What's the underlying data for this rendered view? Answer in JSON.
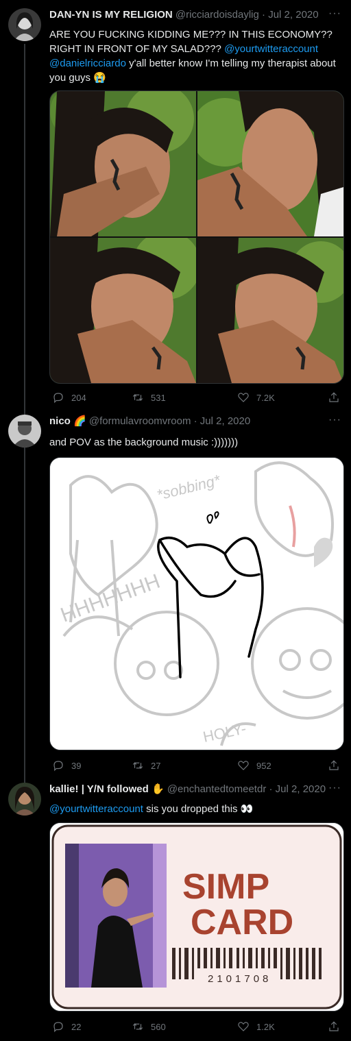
{
  "tweets": [
    {
      "name": "DAN-YN IS MY RELIGION",
      "handle": "@ricciardoisdaylig",
      "date": "Jul 2, 2020",
      "text_line1": "ARE YOU FUCKING KIDDING ME??? IN THIS ECONOMY??",
      "text_line2_a": "RIGHT IN FRONT OF MY SALAD??? ",
      "mention1": "@yourtwitteraccount",
      "mention2": "@danielricciardo",
      "text_line3_b": " y'all better know I'm telling my therapist about",
      "text_line4": "you guys 😭",
      "replies": "204",
      "retweets": "531",
      "likes": "7.2K"
    },
    {
      "name": "nico 🌈",
      "handle": "@formulavroomvroom",
      "date": "Jul 2, 2020",
      "text": "and POV as the background music :)))))))",
      "sketch_texts": [
        "*sobbing*",
        "HHHHHHH",
        "HOLY-"
      ],
      "replies": "39",
      "retweets": "27",
      "likes": "952"
    },
    {
      "name": "kallie! | Y/N followed",
      "handle": "@enchantedtomeetdr",
      "date": "Jul 2, 2020",
      "mention": "@yourtwitteraccount",
      "text": " sis you dropped this 👀",
      "card_title_1": "SIMP",
      "card_title_2": "CARD",
      "card_number": "2101708",
      "replies": "22",
      "retweets": "560",
      "likes": "1.2K"
    }
  ],
  "icons": {
    "reply": "reply-icon",
    "retweet": "retweet-icon",
    "like": "heart-icon",
    "share": "share-icon",
    "more": "more-icon"
  },
  "colors": {
    "background": "#000000",
    "text": "#e7e9ea",
    "secondary": "#71767b",
    "link": "#1d9bf0",
    "simp_card_red": "#a8432f"
  }
}
